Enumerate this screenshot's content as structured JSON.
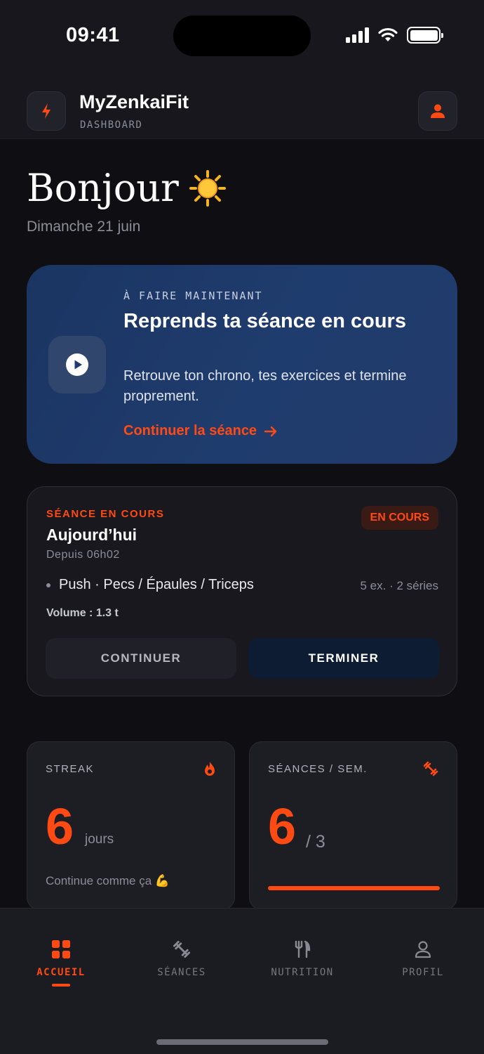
{
  "status_bar": {
    "time": "09:41"
  },
  "header": {
    "title": "MyZenkaiFit",
    "subtitle": "DASHBOARD"
  },
  "greeting": {
    "title": "Bonjour",
    "emoji": "☀️",
    "date": "Dimanche 21 juin"
  },
  "hero": {
    "kicker": "À FAIRE MAINTENANT",
    "title": "Reprends ta séance en cours",
    "description": "Retrouve ton chrono, tes exercices et termine proprement.",
    "link_label": "Continuer la séance"
  },
  "session": {
    "kicker": "SÉANCE EN COURS",
    "title": "Aujourd’hui",
    "since": "Depuis 06h02",
    "badge": "EN COURS",
    "workout": "Push · Pecs / Épaules / Triceps",
    "meta": "5 ex. · 2 séries",
    "volume": "Volume : 1.3 t",
    "continue_label": "CONTINUER",
    "finish_label": "TERMINER"
  },
  "stats": {
    "streak": {
      "label": "STREAK",
      "value": "6",
      "unit": "jours",
      "note": "Continue comme ça 💪"
    },
    "sessions": {
      "label": "SÉANCES / SEM.",
      "value": "6",
      "target": "/ 3",
      "progress": 1.0
    }
  },
  "tabbar": {
    "items": [
      {
        "label": "ACCUEIL",
        "icon": "grid-icon",
        "active": true
      },
      {
        "label": "SÉANCES",
        "icon": "dumbbell-icon",
        "active": false
      },
      {
        "label": "NUTRITION",
        "icon": "fork-knife-icon",
        "active": false
      },
      {
        "label": "PROFIL",
        "icon": "user-icon",
        "active": false
      }
    ]
  },
  "colors": {
    "accent": "#ff4a14",
    "hero_bg": "#1f3c6e",
    "background": "#0f0f13"
  }
}
